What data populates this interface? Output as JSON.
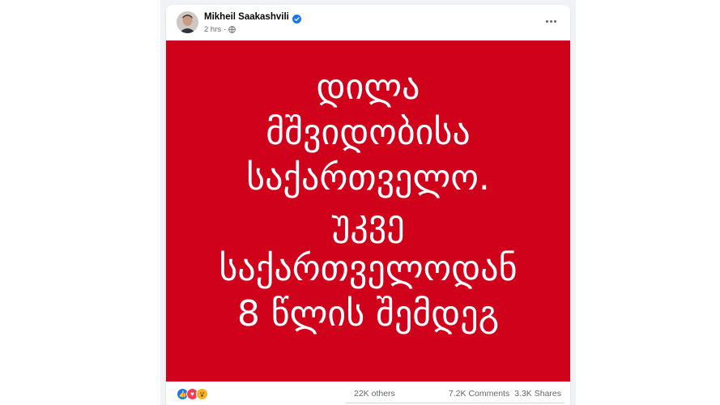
{
  "post": {
    "author": "Mikheil Saakashvili",
    "time": "2 hrs",
    "verified": true,
    "privacy_icon": "globe-icon",
    "more_icon": "ellipsis-icon"
  },
  "image_text": {
    "background": "#d0021b",
    "lines": [
      "დილა",
      "მშვიდობისა",
      "საქართველო.",
      "უკვე",
      "საქართველოდან",
      "8 წლის შემდეგ"
    ]
  },
  "footer": {
    "reaction_icons": [
      "like-icon",
      "love-icon",
      "wow-icon"
    ],
    "others": "22K others",
    "comments": "7.2K Comments",
    "shares": "3.3K Shares"
  },
  "colors": {
    "accent": "#1877f2",
    "feed_background": "#f0f2f5",
    "muted_text": "#65676b"
  }
}
